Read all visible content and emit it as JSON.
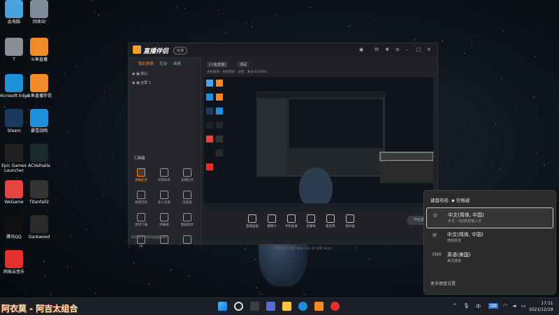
{
  "desktop_icons": [
    {
      "label": "此电脑",
      "color": "#4aa3df"
    },
    {
      "label": "回收站",
      "color": "#7d8d99"
    },
    {
      "label": "T",
      "color": "#8a8f96"
    },
    {
      "label": "斗鱼直播",
      "color": "#f08a2a"
    },
    {
      "label": "Microsoft Edge",
      "color": "#1f8fd6"
    },
    {
      "label": "斗鱼直播伴侣",
      "color": "#f08a2a"
    },
    {
      "label": "Steam",
      "color": "#1b3a5c"
    },
    {
      "label": "暴雪战网",
      "color": "#1f8fe0"
    },
    {
      "label": "Epic Games Launcher",
      "color": "#222222"
    },
    {
      "label": "ACValhalla",
      "color": "#1a2a2a"
    },
    {
      "label": "WeGame",
      "color": "#e84343"
    },
    {
      "label": "Titanfall2",
      "color": "#333333"
    },
    {
      "label": "腾讯QQ",
      "color": "#111111"
    },
    {
      "label": "Darkwood",
      "color": "#2a2a2a"
    },
    {
      "label": "网易云音乐",
      "color": "#e3302f"
    }
  ],
  "app": {
    "name": "直播伴侣",
    "badge": "标准",
    "left_tabs": [
      "我的场景",
      "互动",
      "画质"
    ],
    "scenes": [
      "默认",
      "全屏 1"
    ],
    "tools_title": "工具箱",
    "tools": [
      "弹幕助手",
      "房管助手",
      "主播任务",
      "视频连麦",
      "多人连麦",
      "连麦器",
      "游戏下载",
      "弹幕箱",
      "数据助手",
      "PK",
      "",
      ""
    ],
    "hint": "如何把手机游戏画面投屏?",
    "room_tags": [
      "[斗鱼直播]",
      "测试"
    ],
    "subinfo": "主机房间 · 主机房间 · 分区 · 关注 623910",
    "controls": [
      "直播画面",
      "摄像头",
      "手机投屏",
      "多媒体",
      "麦克风",
      "扬声器"
    ],
    "start_label": "开始直播",
    "status": "CPU 15%   内存 40%   FPS 60   码率 0kb/s",
    "overlay_caption": "阿衣莫 - 阿吉太组合"
  },
  "ime": {
    "header": "键盘布局",
    "header_sub": "空格键",
    "options": [
      {
        "icon": "中",
        "title": "中文(简体, 中国)",
        "sub": "中文 - QQ拼音输入法",
        "selected": true
      },
      {
        "icon": "拼",
        "title": "中文(简体, 中国)",
        "sub": "微软拼音",
        "selected": false
      },
      {
        "icon": "ENG",
        "title": "英语(美国)",
        "sub": "美式键盘",
        "selected": false
      }
    ],
    "more": "更多键盘设置"
  },
  "taskbar": {
    "caption": "阿衣莫 - 阿吉太组合",
    "tray_lang": "中",
    "time": "17:11",
    "date": "2021/12/19"
  }
}
